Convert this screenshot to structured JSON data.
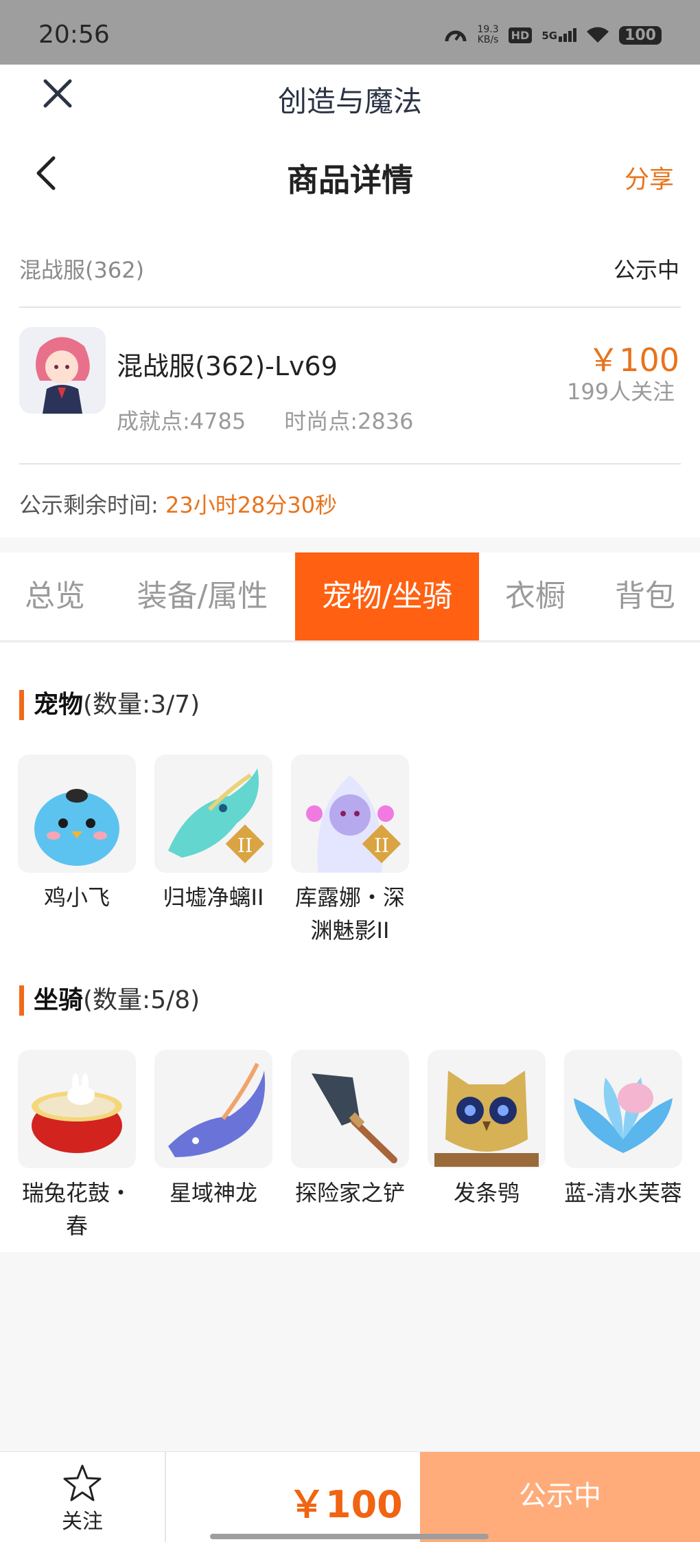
{
  "status_bar": {
    "time": "20:56",
    "net_speed_value": "19.3",
    "net_speed_unit": "KB/s",
    "hd": "HD",
    "network": "5G",
    "battery": "100"
  },
  "app": {
    "title": "创造与魔法"
  },
  "nav": {
    "title": "商品详情",
    "share": "分享"
  },
  "listing": {
    "server": "混战服(362)",
    "state": "公示中",
    "character": "混战服(362)-Lv69",
    "achievement": "成就点:4785",
    "fashion": "时尚点:2836",
    "price": "￥100",
    "followers": "199人关注",
    "countdown_label": "公示剩余时间:",
    "countdown_value": "23小时28分30秒"
  },
  "tabs": [
    {
      "label": "总览"
    },
    {
      "label": "装备/属性"
    },
    {
      "label": "宠物/坐骑"
    },
    {
      "label": "衣橱"
    },
    {
      "label": "背包"
    }
  ],
  "active_tab": "宠物/坐骑",
  "pets": {
    "title": "宠物",
    "count": "(数量:3/7)",
    "items": [
      {
        "name": "鸡小飞"
      },
      {
        "name": "归墟净螭II",
        "badge": "II"
      },
      {
        "name": "库露娜・深渊魅影II",
        "badge": "II"
      }
    ]
  },
  "mounts": {
    "title": "坐骑",
    "count": "(数量:5/8)",
    "items": [
      {
        "name": "瑞兔花鼓・春"
      },
      {
        "name": "星域神龙"
      },
      {
        "name": "探险家之铲"
      },
      {
        "name": "发条鸮"
      },
      {
        "name": "蓝-清水芙蓉"
      }
    ]
  },
  "bottom": {
    "follow": "关注",
    "price": "￥100",
    "cta": "公示中"
  },
  "colors": {
    "accent": "#ff6011",
    "price": "#e8731c",
    "cta": "#ffac7a"
  }
}
